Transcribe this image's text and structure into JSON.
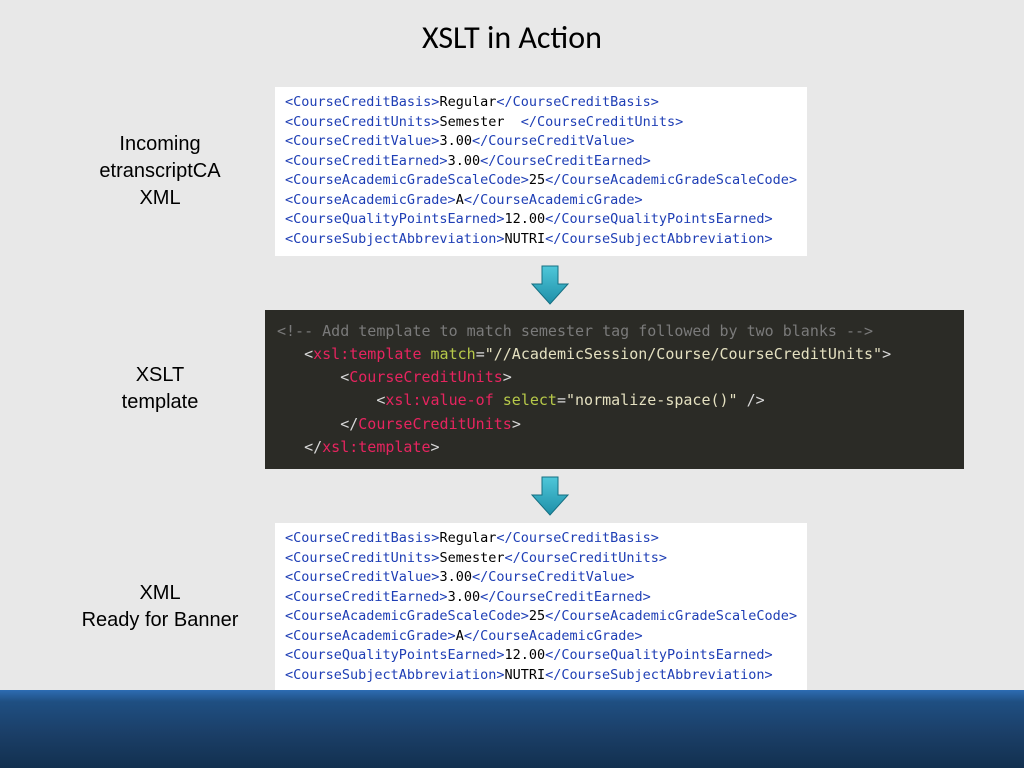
{
  "title": "XSLT in Action",
  "labels": {
    "incoming": "Incoming\netranscriptCA\nXML",
    "xslt": "XSLT\ntemplate",
    "ready": "XML\nReady for Banner"
  },
  "xml1": [
    {
      "tag": "CourseCreditBasis",
      "val": "Regular"
    },
    {
      "tag": "CourseCreditUnits",
      "val": "Semester  "
    },
    {
      "tag": "CourseCreditValue",
      "val": "3.00"
    },
    {
      "tag": "CourseCreditEarned",
      "val": "3.00"
    },
    {
      "tag": "CourseAcademicGradeScaleCode",
      "val": "25"
    },
    {
      "tag": "CourseAcademicGrade",
      "val": "A"
    },
    {
      "tag": "CourseQualityPointsEarned",
      "val": "12.00"
    },
    {
      "tag": "CourseSubjectAbbreviation",
      "val": "NUTRI"
    }
  ],
  "xslt": {
    "comment": "Add template to match semester tag followed by two blanks",
    "matchAttr": "match",
    "matchVal": "//AcademicSession/Course/CourseCreditUnits",
    "innerTag": "CourseCreditUnits",
    "valueEl": "xsl:value-of",
    "selectAttr": "select",
    "selectVal": "normalize-space()",
    "templateEl": "xsl:template"
  },
  "xml2": [
    {
      "tag": "CourseCreditBasis",
      "val": "Regular"
    },
    {
      "tag": "CourseCreditUnits",
      "val": "Semester"
    },
    {
      "tag": "CourseCreditValue",
      "val": "3.00"
    },
    {
      "tag": "CourseCreditEarned",
      "val": "3.00"
    },
    {
      "tag": "CourseAcademicGradeScaleCode",
      "val": "25"
    },
    {
      "tag": "CourseAcademicGrade",
      "val": "A"
    },
    {
      "tag": "CourseQualityPointsEarned",
      "val": "12.00"
    },
    {
      "tag": "CourseSubjectAbbreviation",
      "val": "NUTRI"
    }
  ]
}
